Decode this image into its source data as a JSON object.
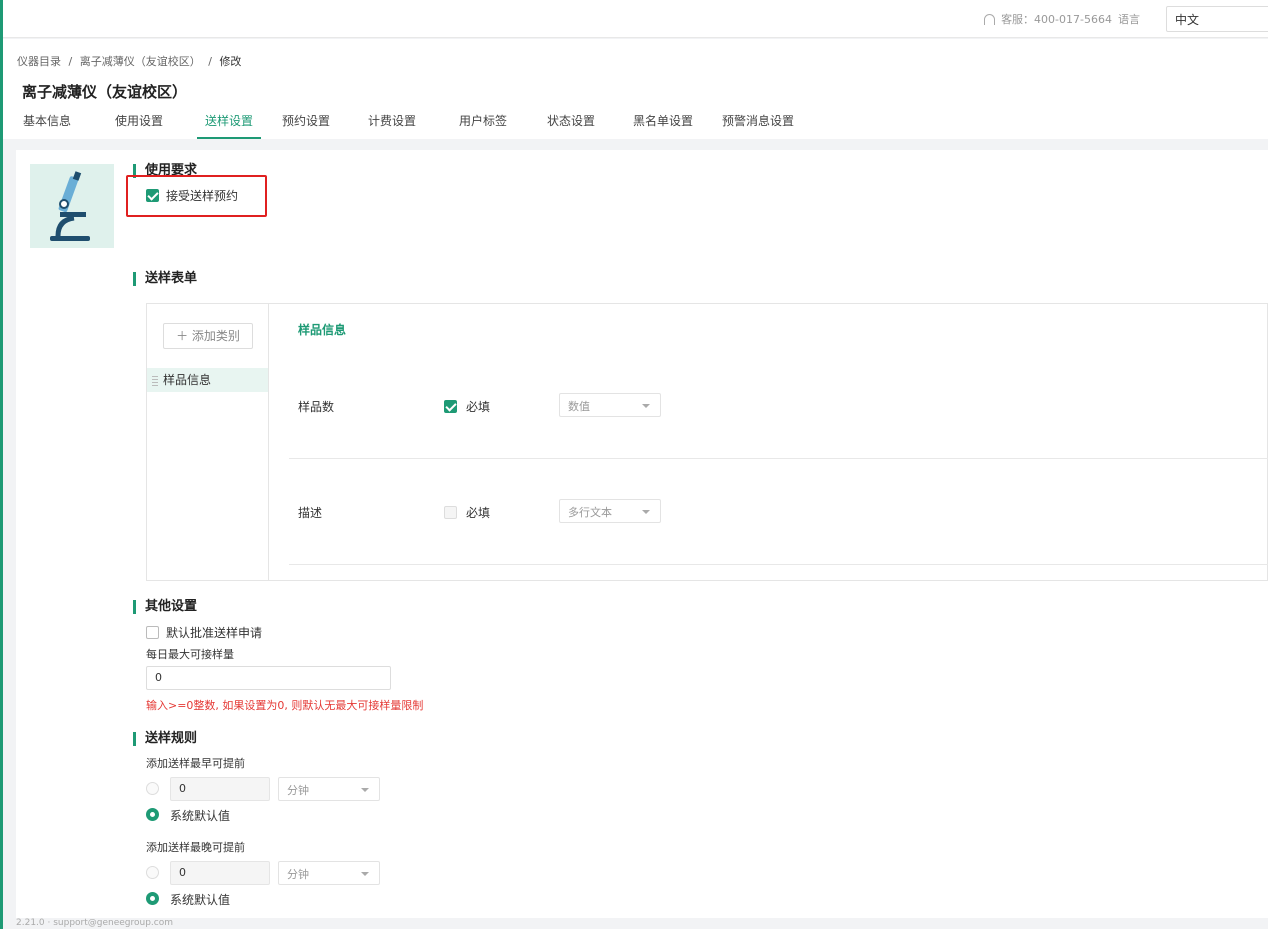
{
  "topbar": {
    "service": "客服：400-017-5664",
    "lang_label": "语言",
    "lang_value": "中文"
  },
  "breadcrumb": [
    "仪器目录",
    "/",
    "离子减薄仪（友谊校区）",
    "/",
    "修改"
  ],
  "title": "离子减薄仪（友谊校区）",
  "tabs": [
    "基本信息",
    "使用设置",
    "送样设置",
    "预约设置",
    "计费设置",
    "用户标签",
    "状态设置",
    "黑名单设置",
    "预警消息设置"
  ],
  "active_tab": "送样设置",
  "usage": {
    "title": "使用要求",
    "accept_label": "接受送样预约",
    "accept_checked": true
  },
  "form": {
    "title": "送样表单",
    "add_category": "添加类别",
    "categories": [
      "样品信息"
    ],
    "panel_title": "样品信息",
    "fields": [
      {
        "name": "样品数",
        "required": true,
        "required_label": "必填",
        "type": "数值"
      },
      {
        "name": "描述",
        "required": false,
        "required_label": "必填",
        "type": "多行文本"
      }
    ]
  },
  "other": {
    "title": "其他设置",
    "auto_approve": "默认批准送样申请",
    "max_label": "每日最大可接样量",
    "max_value": "0",
    "hint": "输入>=0整数, 如果设置为0, 则默认无最大可接样量限制"
  },
  "rules": {
    "title": "送样规则",
    "earliest_label": "添加送样最早可提前",
    "earliest_value": "0",
    "earliest_unit": "分钟",
    "earliest_default": "系统默认值",
    "latest_label": "添加送样最晚可提前",
    "latest_value": "0",
    "latest_unit": "分钟",
    "latest_default": "系统默认值"
  },
  "footer": "2.21.0 · support@geneegroup.com",
  "colors": {
    "accent": "#1e9a75",
    "warning": "#e53935",
    "highlight": "#e02020"
  }
}
